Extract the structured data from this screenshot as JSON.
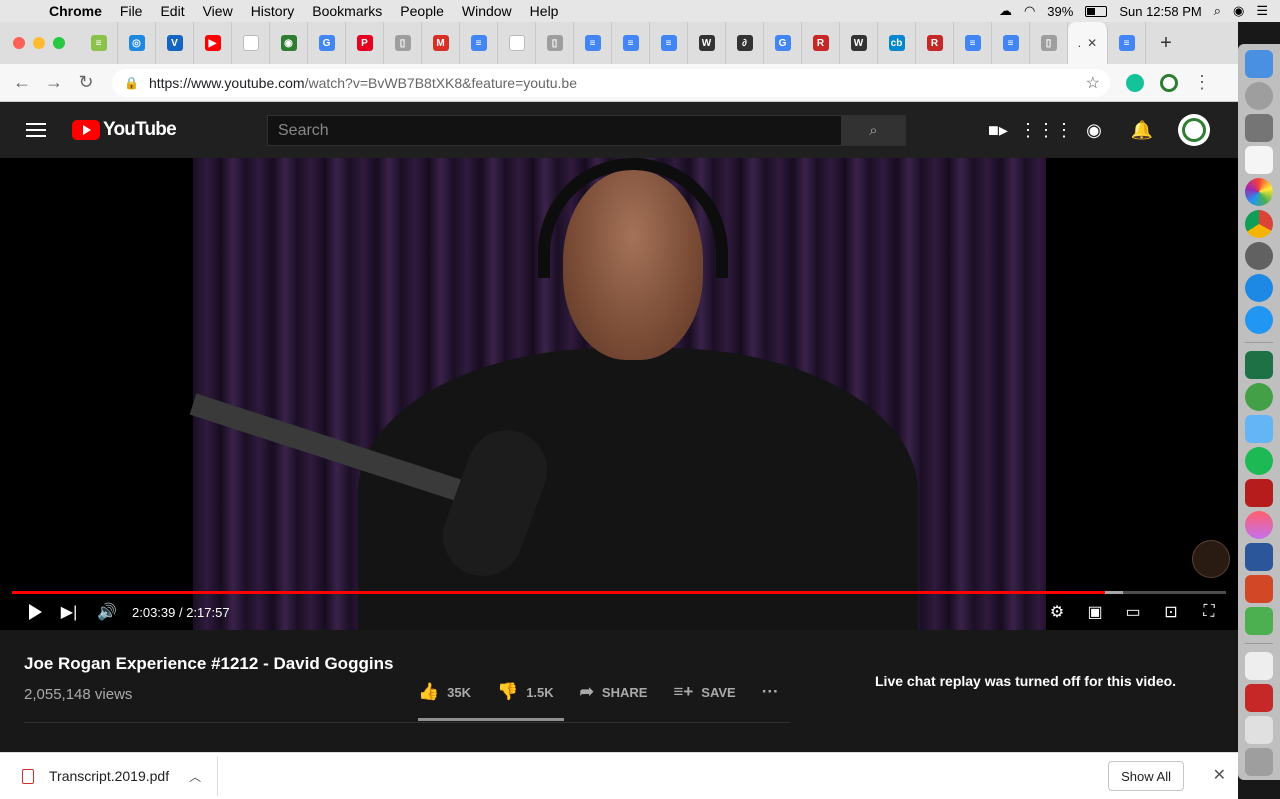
{
  "menubar": {
    "items": [
      "Chrome",
      "File",
      "Edit",
      "View",
      "History",
      "Bookmarks",
      "People",
      "Window",
      "Help"
    ],
    "battery": "39%",
    "clock": "Sun 12:58 PM"
  },
  "browser": {
    "tab_icons": [
      {
        "name": "tab-streameast",
        "color": "#8bc34a",
        "glyph": "≡"
      },
      {
        "name": "tab-fingerprint",
        "color": "#1e88e5",
        "glyph": "◎"
      },
      {
        "name": "tab-venmo",
        "color": "#1565c0",
        "glyph": "V"
      },
      {
        "name": "tab-youtube",
        "color": "#ff0000",
        "glyph": "▶"
      },
      {
        "name": "tab-blank-1",
        "color": "#ffffff",
        "glyph": ""
      },
      {
        "name": "tab-copyleaks",
        "color": "#2e7d32",
        "glyph": "◉"
      },
      {
        "name": "tab-google-1",
        "color": "#4285f4",
        "glyph": "G"
      },
      {
        "name": "tab-pinterest",
        "color": "#e60023",
        "glyph": "P"
      },
      {
        "name": "tab-doc-1",
        "color": "#9e9e9e",
        "glyph": "▯"
      },
      {
        "name": "tab-gmail",
        "color": "#d93025",
        "glyph": "M"
      },
      {
        "name": "tab-gdocs-1",
        "color": "#4285f4",
        "glyph": "≡"
      },
      {
        "name": "tab-blank-2",
        "color": "#ffffff",
        "glyph": ""
      },
      {
        "name": "tab-doc-2",
        "color": "#9e9e9e",
        "glyph": "▯"
      },
      {
        "name": "tab-gdocs-2",
        "color": "#4285f4",
        "glyph": "≡"
      },
      {
        "name": "tab-gdocs-3",
        "color": "#4285f4",
        "glyph": "≡"
      },
      {
        "name": "tab-gdocs-4",
        "color": "#4285f4",
        "glyph": "≡"
      },
      {
        "name": "tab-wikipedia-1",
        "color": "#333333",
        "glyph": "W"
      },
      {
        "name": "tab-script",
        "color": "#333333",
        "glyph": "∂"
      },
      {
        "name": "tab-google-2",
        "color": "#4285f4",
        "glyph": "G"
      },
      {
        "name": "tab-r-1",
        "color": "#c62828",
        "glyph": "R"
      },
      {
        "name": "tab-wikipedia-2",
        "color": "#333333",
        "glyph": "W"
      },
      {
        "name": "tab-cb",
        "color": "#0288d1",
        "glyph": "cb"
      },
      {
        "name": "tab-r-2",
        "color": "#c62828",
        "glyph": "R"
      },
      {
        "name": "tab-gdocs-5",
        "color": "#4285f4",
        "glyph": "≡"
      },
      {
        "name": "tab-gdocs-6",
        "color": "#4285f4",
        "glyph": "≡"
      },
      {
        "name": "tab-doc-3",
        "color": "#9e9e9e",
        "glyph": "▯"
      }
    ],
    "active_tab_label": ".",
    "url_main": "https://www.youtube.com",
    "url_rest": "/watch?v=BvWB7B8tXK8&feature=youtu.be"
  },
  "youtube": {
    "logo_text": "YouTube",
    "search_placeholder": "Search",
    "player": {
      "time_current": "2:03:39",
      "time_total": "2:17:57",
      "time_separator": " / ",
      "progress_fraction": 0.9,
      "buffer_fraction": 0.915
    },
    "video": {
      "title": "Joe Rogan Experience #1212 - David Goggins",
      "views": "2,055,148 views",
      "likes": "35K",
      "dislikes": "1.5K",
      "share_label": "SHARE",
      "save_label": "SAVE"
    },
    "chat_message": "Live chat replay was turned off for this video."
  },
  "downloads": {
    "file_name": "Transcript.2019.pdf",
    "show_all_label": "Show All"
  },
  "colors": {
    "youtube_red": "#ff0000",
    "youtube_dark": "#181818",
    "header_dark": "#202020"
  }
}
